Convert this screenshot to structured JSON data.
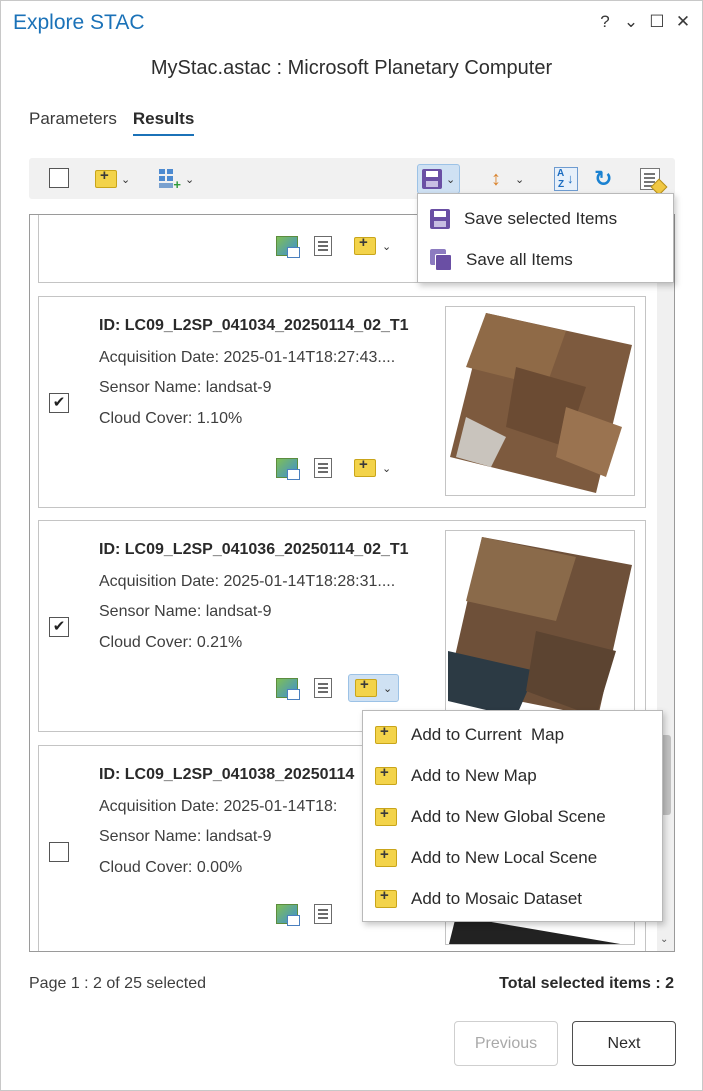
{
  "window": {
    "title": "Explore STAC",
    "controls": {
      "help": "?",
      "menu": "⌄",
      "maximize": "☐",
      "close": "✕"
    }
  },
  "subtitle": "MyStac.astac : Microsoft Planetary Computer",
  "tabs": [
    {
      "label": "Parameters",
      "active": false
    },
    {
      "label": "Results",
      "active": true
    }
  ],
  "toolbar": {
    "select_all_checked": false,
    "icons": [
      "add-to-map-icon",
      "add-grid-icon",
      "save-icon",
      "sort-icon",
      "sort-az-icon",
      "refresh-icon",
      "report-icon"
    ]
  },
  "save_menu": {
    "items": [
      {
        "label": "Save selected Items",
        "icon": "save-icon"
      },
      {
        "label": "Save all Items",
        "icon": "save-multiple-icon"
      }
    ]
  },
  "results": [
    {
      "id": "ID: LC09_L2SP_041034_20250114_02_T1",
      "acquisition": "Acquisition Date: 2025-01-14T18:27:43....",
      "sensor": "Sensor Name: landsat-9",
      "cloud": "Cloud Cover: 1.10%",
      "checked": true,
      "check_mark": "✔"
    },
    {
      "id": "ID: LC09_L2SP_041036_20250114_02_T1",
      "acquisition": "Acquisition Date: 2025-01-14T18:28:31....",
      "sensor": "Sensor Name: landsat-9",
      "cloud": "Cloud Cover: 0.21%",
      "checked": true,
      "check_mark": "✔"
    },
    {
      "id": "ID: LC09_L2SP_041038_20250114",
      "acquisition": "Acquisition Date: 2025-01-14T18:",
      "sensor": "Sensor Name: landsat-9",
      "cloud": "Cloud Cover: 0.00%",
      "checked": false,
      "check_mark": ""
    }
  ],
  "add_menu": {
    "items": [
      {
        "label": "Add to Current  Map",
        "icon": "add-to-map-icon"
      },
      {
        "label": "Add to New Map",
        "icon": "add-to-map-icon"
      },
      {
        "label": "Add to New Global Scene",
        "icon": "add-to-map-icon"
      },
      {
        "label": "Add to New Local Scene",
        "icon": "add-to-map-icon"
      },
      {
        "label": "Add to Mosaic Dataset",
        "icon": "add-to-map-icon"
      }
    ]
  },
  "footer": {
    "page_info": "Page 1 : 2 of 25 selected",
    "total": "Total selected items : 2",
    "previous_label": "Previous",
    "next_label": "Next"
  },
  "colors": {
    "accent": "#1b72b8",
    "selected_bg": "#cfe1f3"
  }
}
